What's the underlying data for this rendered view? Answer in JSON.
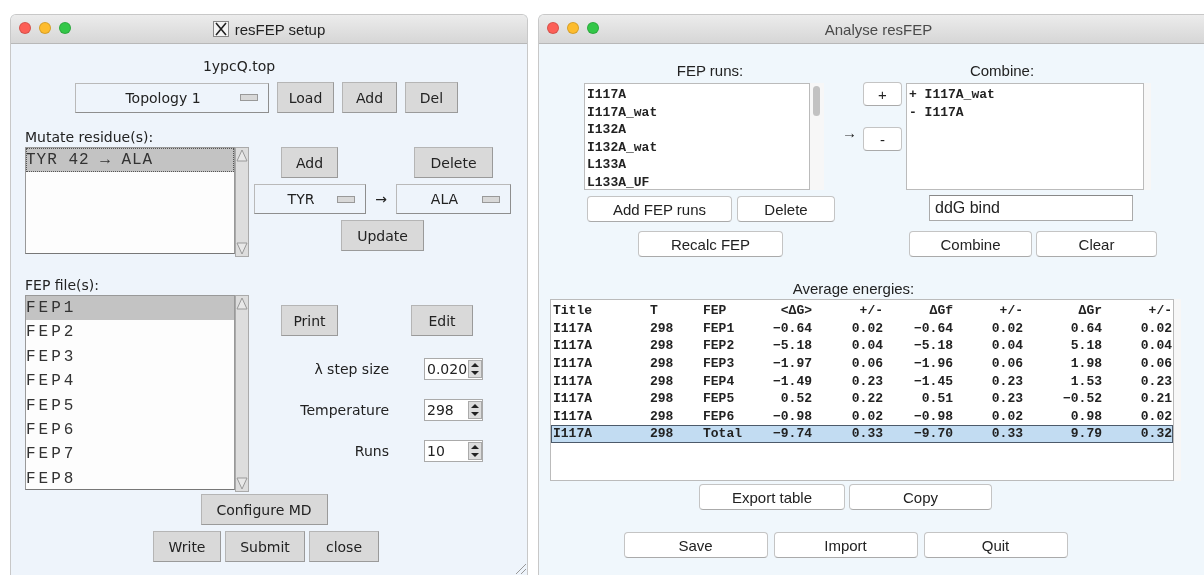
{
  "setup_window": {
    "title": "resFEP setup",
    "topology_file": "1ypcQ.top",
    "topology_select": "Topology 1",
    "topology_buttons": [
      "Load",
      "Add",
      "Del"
    ],
    "mutate_label": "Mutate residue(s):",
    "mutations": [
      {
        "text": "TYR 42 → ALA",
        "selected": true
      }
    ],
    "mutation_buttons": [
      "Add",
      "Delete"
    ],
    "from_residue": "TYR",
    "arrow": "→",
    "to_residue": "ALA",
    "update_button": "Update",
    "fep_label": "FEP file(s):",
    "fep_files": [
      {
        "text": "FEP1",
        "selected": true
      },
      {
        "text": "FEP2",
        "selected": false
      },
      {
        "text": "FEP3",
        "selected": false
      },
      {
        "text": "FEP4",
        "selected": false
      },
      {
        "text": "FEP5",
        "selected": false
      },
      {
        "text": "FEP6",
        "selected": false
      },
      {
        "text": "FEP7",
        "selected": false
      },
      {
        "text": "FEP8",
        "selected": false
      }
    ],
    "fep_buttons": [
      "Print",
      "Edit"
    ],
    "settings": [
      {
        "label": "λ step size",
        "value": "0.020"
      },
      {
        "label": "Temperature",
        "value": "298"
      },
      {
        "label": "Runs",
        "value": "10"
      }
    ],
    "configure_button": "Configure MD",
    "bottom_buttons": [
      "Write",
      "Submit",
      "close"
    ]
  },
  "analyse_window": {
    "title": "Analyse resFEP",
    "fep_runs_label": "FEP runs:",
    "fep_runs": [
      "I117A",
      "I117A_wat",
      "I132A",
      "I132A_wat",
      "L133A",
      "L133A_UF"
    ],
    "fep_runs_buttons": [
      "Add FEP runs",
      "Delete"
    ],
    "recalc_button": "Recalc FEP",
    "arrow": "→",
    "plus_button": "+",
    "minus_button": "-",
    "combine_label": "Combine:",
    "combine_items": [
      "+ I117A_wat",
      "- I117A"
    ],
    "combine_name": "ddG bind",
    "combine_buttons": [
      "Combine",
      "Clear"
    ],
    "table_title": "Average energies:",
    "table": {
      "columns": [
        "Title",
        "T",
        "FEP",
        "<ΔG>",
        "+/-",
        "ΔGf",
        "+/-",
        "ΔGr",
        "+/-"
      ],
      "rows": [
        {
          "cells": [
            "I117A",
            "298",
            "FEP1",
            "−0.64",
            "0.02",
            "−0.64",
            "0.02",
            "0.64",
            "0.02"
          ],
          "selected": false
        },
        {
          "cells": [
            "I117A",
            "298",
            "FEP2",
            "−5.18",
            "0.04",
            "−5.18",
            "0.04",
            "5.18",
            "0.04"
          ],
          "selected": false
        },
        {
          "cells": [
            "I117A",
            "298",
            "FEP3",
            "−1.97",
            "0.06",
            "−1.96",
            "0.06",
            "1.98",
            "0.06"
          ],
          "selected": false
        },
        {
          "cells": [
            "I117A",
            "298",
            "FEP4",
            "−1.49",
            "0.23",
            "−1.45",
            "0.23",
            "1.53",
            "0.23"
          ],
          "selected": false
        },
        {
          "cells": [
            "I117A",
            "298",
            "FEP5",
            "0.52",
            "0.22",
            "0.51",
            "0.23",
            "−0.52",
            "0.21"
          ],
          "selected": false
        },
        {
          "cells": [
            "I117A",
            "298",
            "FEP6",
            "−0.98",
            "0.02",
            "−0.98",
            "0.02",
            "0.98",
            "0.02"
          ],
          "selected": false
        },
        {
          "cells": [
            "I117A",
            "298",
            "Total",
            "−9.74",
            "0.33",
            "−9.70",
            "0.33",
            "9.79",
            "0.32"
          ],
          "selected": true
        }
      ]
    },
    "table_buttons": [
      "Export table",
      "Copy"
    ],
    "bottom_buttons": [
      "Save",
      "Import",
      "Quit"
    ]
  }
}
